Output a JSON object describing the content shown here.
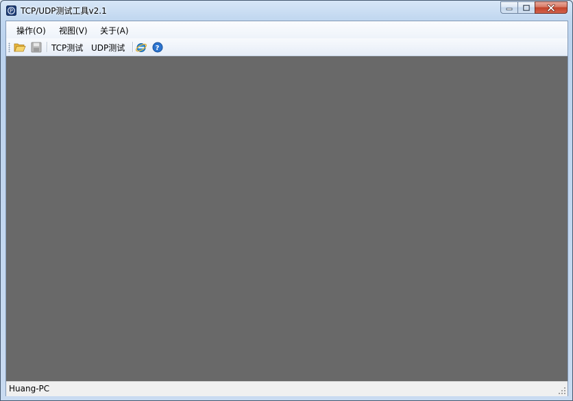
{
  "window": {
    "title": "TCP/UDP测试工具v2.1",
    "controls": {
      "minimize": "minimize",
      "maximize": "maximize",
      "close": "close"
    }
  },
  "menu": [
    {
      "label": "操作(O)"
    },
    {
      "label": "视图(V)"
    },
    {
      "label": "关于(A)"
    }
  ],
  "toolbar": {
    "open_icon": "folder-open-icon",
    "save_icon": "save-icon",
    "tcp_label": "TCP测试",
    "udp_label": "UDP测试",
    "browser_icon": "internet-explorer-icon",
    "help_icon": "help-icon"
  },
  "status": {
    "host": "Huang-PC"
  },
  "colors": {
    "workspace": "#696969",
    "close_button": "#c2432a",
    "frame": "#bcd3ee"
  }
}
